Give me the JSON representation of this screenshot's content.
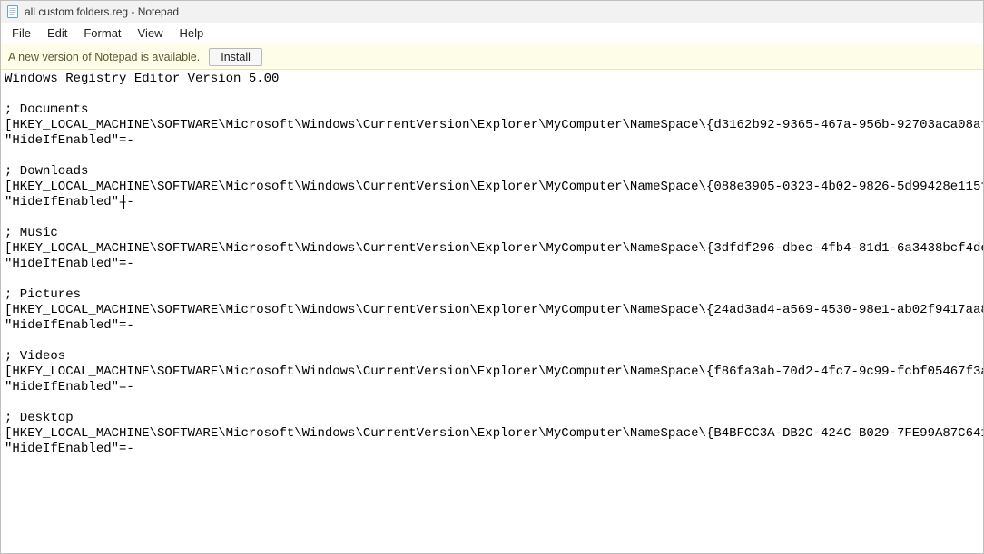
{
  "window": {
    "title": "all custom folders.reg - Notepad"
  },
  "menu": {
    "file": "File",
    "edit": "Edit",
    "format": "Format",
    "view": "View",
    "help": "Help"
  },
  "infobar": {
    "text": "A new version of Notepad is available.",
    "install_label": "Install"
  },
  "editor": {
    "content": "Windows Registry Editor Version 5.00\n\n; Documents\n[HKEY_LOCAL_MACHINE\\SOFTWARE\\Microsoft\\Windows\\CurrentVersion\\Explorer\\MyComputer\\NameSpace\\{d3162b92-9365-467a-956b-92703aca08af}]\n\"HideIfEnabled\"=-\n\n; Downloads\n[HKEY_LOCAL_MACHINE\\SOFTWARE\\Microsoft\\Windows\\CurrentVersion\\Explorer\\MyComputer\\NameSpace\\{088e3905-0323-4b02-9826-5d99428e115f}]\n\"HideIfEnabled\"=-\n\n; Music\n[HKEY_LOCAL_MACHINE\\SOFTWARE\\Microsoft\\Windows\\CurrentVersion\\Explorer\\MyComputer\\NameSpace\\{3dfdf296-dbec-4fb4-81d1-6a3438bcf4de}]\n\"HideIfEnabled\"=-\n\n; Pictures\n[HKEY_LOCAL_MACHINE\\SOFTWARE\\Microsoft\\Windows\\CurrentVersion\\Explorer\\MyComputer\\NameSpace\\{24ad3ad4-a569-4530-98e1-ab02f9417aa8}]\n\"HideIfEnabled\"=-\n\n; Videos\n[HKEY_LOCAL_MACHINE\\SOFTWARE\\Microsoft\\Windows\\CurrentVersion\\Explorer\\MyComputer\\NameSpace\\{f86fa3ab-70d2-4fc7-9c99-fcbf05467f3a}]\n\"HideIfEnabled\"=-\n\n; Desktop\n[HKEY_LOCAL_MACHINE\\SOFTWARE\\Microsoft\\Windows\\CurrentVersion\\Explorer\\MyComputer\\NameSpace\\{B4BFCC3A-DB2C-424C-B029-7FE99A87C641}]\n\"HideIfEnabled\"=-\n",
    "caret_line": 8,
    "caret_col": 17
  }
}
